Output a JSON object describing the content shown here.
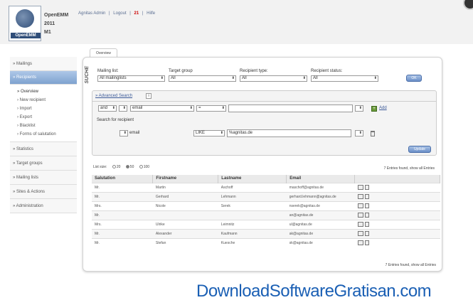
{
  "header": {
    "logo_text": "OpenEMM",
    "app_name_line1": "OpenEMM",
    "app_name_line2": "2011",
    "app_name_line3": "M1",
    "user_link": "Agnitas Admin",
    "logout_link": "Logout",
    "count": "21",
    "help_link": "Hilfe"
  },
  "sidebar": {
    "items": [
      {
        "label": "» Mailings"
      },
      {
        "label": "» Recipients"
      },
      {
        "label": "» Statistics"
      },
      {
        "label": "» Target groups"
      },
      {
        "label": "» Mailing lists"
      },
      {
        "label": "» Sites & Actions"
      },
      {
        "label": "» Administration"
      }
    ],
    "subitems": [
      {
        "label": "» Overview"
      },
      {
        "label": "› New recipient"
      },
      {
        "label": "› Import"
      },
      {
        "label": "› Export"
      },
      {
        "label": "› Blacklist"
      },
      {
        "label": "› Forms of salutation"
      }
    ]
  },
  "tab": {
    "label": "Overview"
  },
  "filters": {
    "section_label": "SUCHE",
    "mailing_list_label": "Mailing list:",
    "mailing_list_value": "All mailinglists",
    "target_group_label": "Target group",
    "target_group_value": "All",
    "recipient_type_label": "Recipient type:",
    "recipient_type_value": "All",
    "recipient_status_label": "Recipient status:",
    "recipient_status_value": "All",
    "ok_label": "OK"
  },
  "advanced": {
    "header": "» Advanced Search",
    "help": "i",
    "op_value": "and",
    "field_value": "email",
    "comparator_value": "=",
    "add_label": "Add",
    "search_for_label": "Search for recipient",
    "row_field_label": "email",
    "row_comparator_value": "LIKE",
    "row_value": "%agnitas.de",
    "update_label": "Update"
  },
  "list": {
    "list_size_label": "List size:",
    "sizes": [
      "20",
      "50",
      "100"
    ],
    "entries_summary": "7 Entries found, show all Entries",
    "entries_summary_bottom": "7 Entries found, show all Entries",
    "columns": [
      "Salutation",
      "Firstname",
      "Lastname",
      "Email"
    ],
    "rows": [
      [
        "Mr.",
        "Martin",
        "Aschoff",
        "maschoff@agnitas.de"
      ],
      [
        "Mr.",
        "Gerhard",
        "Lehmann",
        "gerhard.lehmann@agnitas.de"
      ],
      [
        "Mrs.",
        "Nicole",
        "Serek",
        "nserek@agnitas.de"
      ],
      [
        "Mr.",
        "",
        "",
        "an@agnitas.de"
      ],
      [
        "Mrs.",
        "Ulrike",
        "Leimnitz",
        "ul@agnitas.de"
      ],
      [
        "Mr.",
        "Alexander",
        "Kaufmann",
        "ak@agnitas.de"
      ],
      [
        "Mr.",
        "Stefan",
        "Kuesche",
        "sk@agnitas.de"
      ]
    ]
  },
  "watermark": "DownloadSoftwareGratisan.com"
}
